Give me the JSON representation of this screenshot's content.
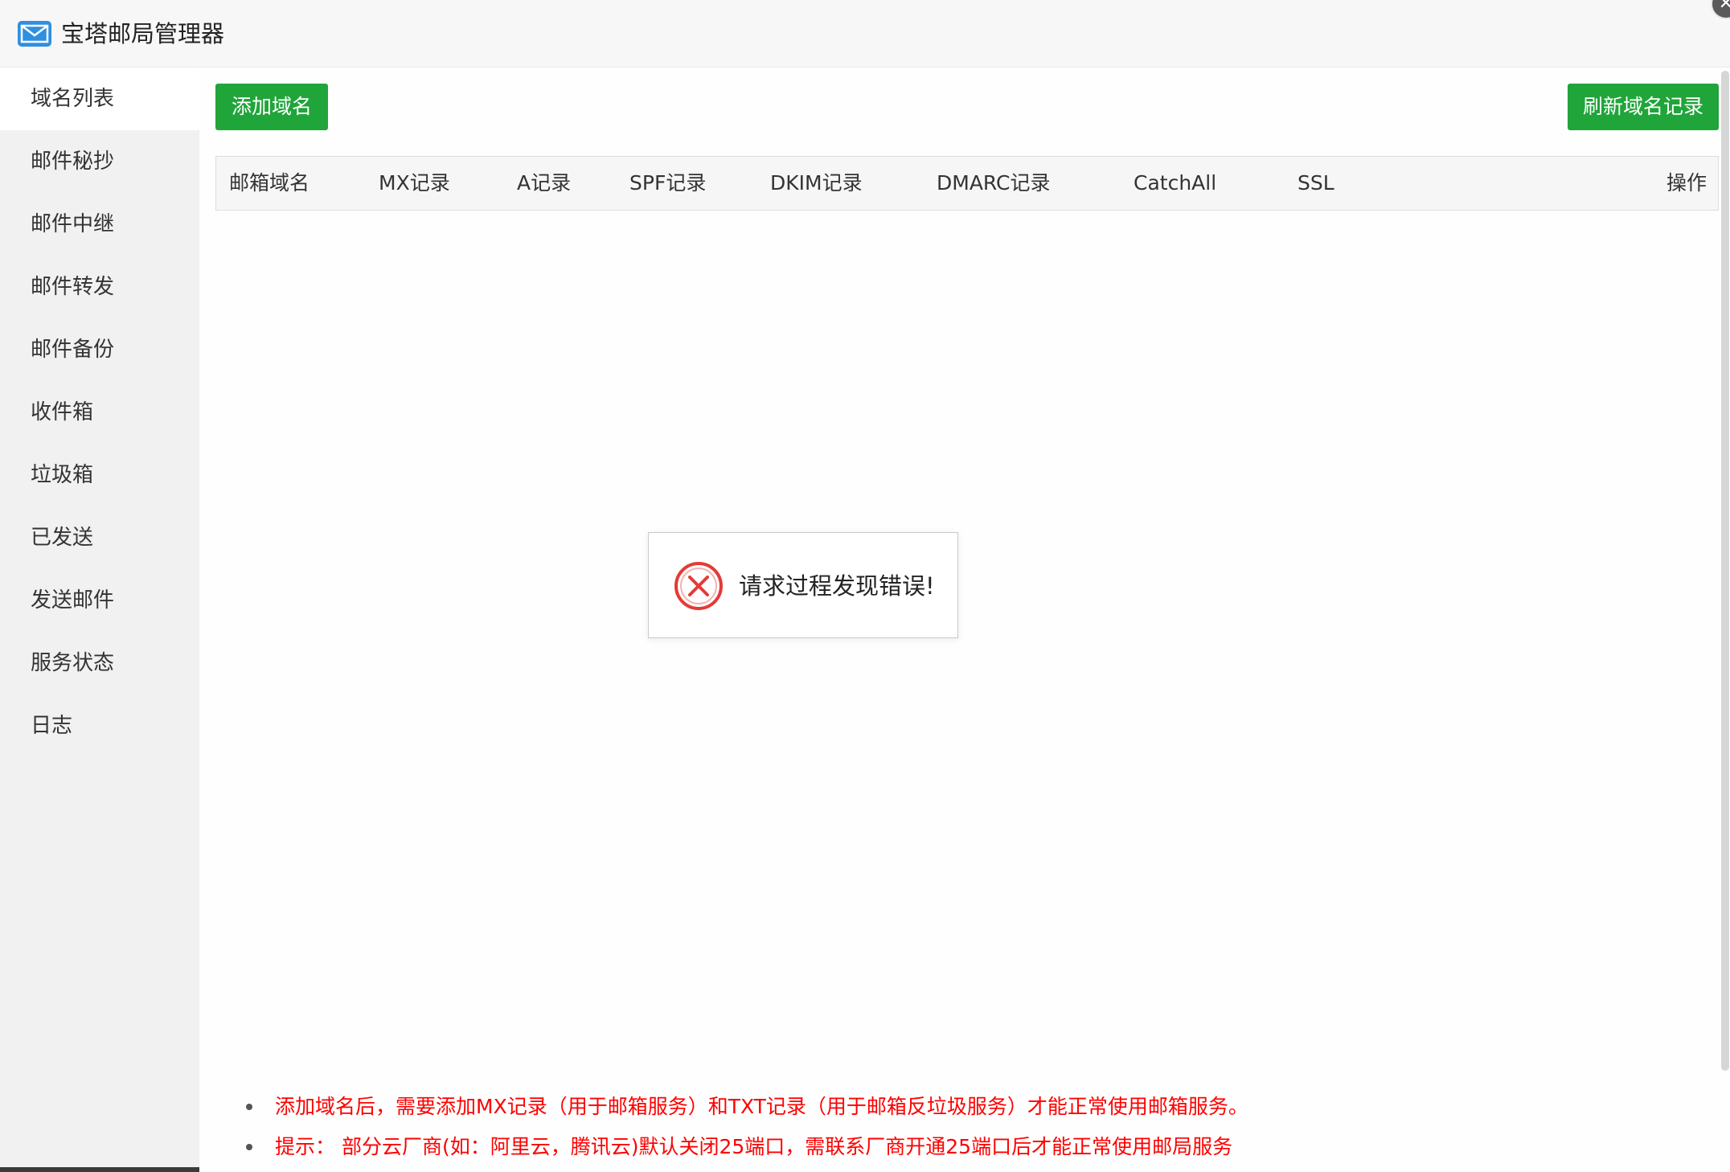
{
  "app": {
    "title": "宝塔邮局管理器",
    "icon": "mail-envelope-icon",
    "close_glyph": "✕"
  },
  "sidebar": {
    "items": [
      {
        "label": "域名列表",
        "active": true
      },
      {
        "label": "邮件秘抄",
        "active": false
      },
      {
        "label": "邮件中继",
        "active": false
      },
      {
        "label": "邮件转发",
        "active": false
      },
      {
        "label": "邮件备份",
        "active": false
      },
      {
        "label": "收件箱",
        "active": false
      },
      {
        "label": "垃圾箱",
        "active": false
      },
      {
        "label": "已发送",
        "active": false
      },
      {
        "label": "发送邮件",
        "active": false
      },
      {
        "label": "服务状态",
        "active": false
      },
      {
        "label": "日志",
        "active": false
      }
    ]
  },
  "toolbar": {
    "add_label": "添加域名",
    "refresh_label": "刷新域名记录"
  },
  "table": {
    "columns": [
      "邮箱域名",
      "MX记录",
      "A记录",
      "SPF记录",
      "DKIM记录",
      "DMARC记录",
      "CatchAll",
      "SSL",
      "操作"
    ],
    "rows": []
  },
  "toast": {
    "icon": "error-circle-x-icon",
    "message": "请求过程发现错误!"
  },
  "notes": [
    "添加域名后，需要添加MX记录（用于邮箱服务）和TXT记录（用于邮箱反垃圾服务）才能正常使用邮箱服务。",
    "提示： 部分云厂商(如：阿里云，腾讯云)默认关闭25端口，需联系厂商开通25端口后才能正常使用邮局服务"
  ],
  "colors": {
    "accent_green": "#20a53a",
    "error_red": "#e33b36",
    "note_red": "#ff0000",
    "icon_blue": "#2f8fe0"
  }
}
